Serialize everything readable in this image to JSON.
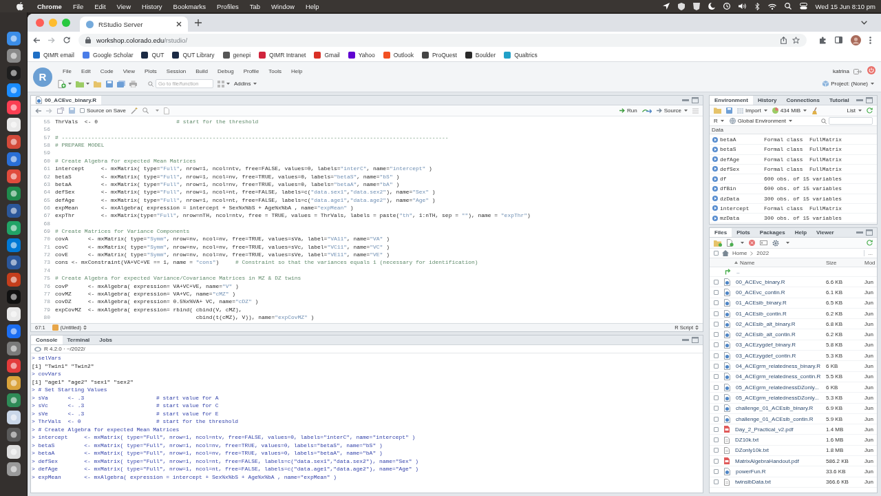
{
  "menubar": {
    "app": "Chrome",
    "items": [
      "File",
      "Edit",
      "View",
      "History",
      "Bookmarks",
      "Profiles",
      "Tab",
      "Window",
      "Help"
    ],
    "clock": "Wed 15 Jun 8:10 pm"
  },
  "browser": {
    "tabs": [
      {
        "title": "RStudio Server",
        "selected": true
      }
    ],
    "url": {
      "host": "workshop.colorado.edu",
      "path": "/rstudio/"
    },
    "bookmarks": [
      {
        "label": "QIMR email",
        "color": "#1f6fc5"
      },
      {
        "label": "Google Scholar",
        "color": "#4a7de8"
      },
      {
        "label": "QUT",
        "color": "#1b2a44"
      },
      {
        "label": "QUT Library",
        "color": "#1b2a44"
      },
      {
        "label": "genepi",
        "color": "#555555"
      },
      {
        "label": "QIMR Intranet",
        "color": "#d0243c"
      },
      {
        "label": "Gmail",
        "color": "#d93025"
      },
      {
        "label": "Yahoo",
        "color": "#5f01d1"
      },
      {
        "label": "Outlook",
        "color": "#f25022"
      },
      {
        "label": "ProQuest",
        "color": "#444444"
      },
      {
        "label": "Boulder",
        "color": "#2a2a2a"
      },
      {
        "label": "Qualtrics",
        "color": "#21a0c8"
      }
    ]
  },
  "rstudio": {
    "logo": "R",
    "menu": [
      "File",
      "Edit",
      "Code",
      "View",
      "Plots",
      "Session",
      "Build",
      "Debug",
      "Profile",
      "Tools",
      "Help"
    ],
    "user": "katrina",
    "goto": {
      "placeholder": "Go to file/function"
    },
    "addins": "Addins",
    "project": "Project: (None)",
    "editor": {
      "tabs": [
        {
          "label": "00_ACEvc_binary.R",
          "selected": true
        }
      ],
      "source_on_save": {
        "label": "Source on Save",
        "checked": false
      },
      "run": "Run",
      "source": "Source",
      "lines": [
        {
          "number": "55",
          "code": "ThrVals  <- 0                        # start for the threshold"
        },
        {
          "number": "56"
        },
        {
          "number": "57",
          "code": "# ----------------------------------------------------------------------------------------------------------------------"
        },
        {
          "number": "58",
          "code": "# PREPARE MODEL"
        },
        {
          "number": "59"
        },
        {
          "number": "60",
          "code": "# Create Algebra for expected Mean Matrices"
        },
        {
          "number": "61",
          "code": "intercept     <- mxMatrix( type=\"Full\", nrow=1, ncol=ntv, free=FALSE, values=0, labels=\"interC\", name=\"intercept\" )"
        },
        {
          "number": "62",
          "code": "betaS         <- mxMatrix( type=\"Full\", nrow=1, ncol=nv, free=TRUE, values=0, labels=\"betaS\", name=\"bS\" )"
        },
        {
          "number": "63",
          "code": "betaA         <- mxMatrix( type=\"Full\", nrow=1, ncol=nv, free=TRUE, values=0, labels=\"betaA\", name=\"bA\" )"
        },
        {
          "number": "64",
          "code": "defSex        <- mxMatrix( type=\"Full\", nrow=1, ncol=nt, free=FALSE, labels=c(\"data.sex1\",\"data.sex2\"), name=\"Sex\" )"
        },
        {
          "number": "65",
          "code": "defAge        <- mxMatrix( type=\"Full\", nrow=1, ncol=nt, free=FALSE, labels=c(\"data.age1\",\"data.age2\"), name=\"Age\" )"
        },
        {
          "number": "66",
          "code": "expMean       <- mxAlgebra( expression = intercept + Sex%x%bS + Age%x%bA , name=\"expMean\" )"
        },
        {
          "number": "67",
          "code": "expThr        <- mxMatrix(type=\"Full\", nrow=nTH, ncol=ntv, free = TRUE, values = ThrVals, labels = paste(\"th\", 1:nTH, sep = \"\"), name = \"expThr\")"
        },
        {
          "number": "68"
        },
        {
          "number": "69",
          "code": "# Create Matrices for Variance Components"
        },
        {
          "number": "70",
          "code": "covA      <- mxMatrix( type=\"Symm\", nrow=nv, ncol=nv, free=TRUE, values=sVa, label=\"VA11\", name=\"VA\" )"
        },
        {
          "number": "71",
          "code": "covC      <- mxMatrix( type=\"Symm\", nrow=nv, ncol=nv, free=TRUE, values=sVc, label=\"VC11\", name=\"VC\" )"
        },
        {
          "number": "72",
          "code": "covE      <- mxMatrix( type=\"Symm\", nrow=nv, ncol=nv, free=TRUE, values=sVe, label=\"VE11\", name=\"VE\" )"
        },
        {
          "number": "73",
          "code": "cons <- mxConstraint(VA+VC+VE == 1, name = \"cons\")     # Constraint so that the variances equals 1 (necessary for identification)"
        },
        {
          "number": "74"
        },
        {
          "number": "75",
          "code": "# Create Algebra for expected Variance/Covariance Matrices in MZ & DZ twins"
        },
        {
          "number": "76",
          "code": "covP      <- mxAlgebra( expression= VA+VC+VE, name=\"V\" )"
        },
        {
          "number": "77",
          "code": "covMZ     <- mxAlgebra( expression= VA+VC, name=\"cMZ\" )"
        },
        {
          "number": "78",
          "code": "covDZ     <- mxAlgebra( expression= 0.5%x%VA+ VC, name=\"cDZ\" )"
        },
        {
          "number": "79",
          "code": "expCovMZ  <- mxAlgebra( expression= rbind( cbind(V, cMZ),"
        },
        {
          "number": "80",
          "code": "                                           cbind(t(cMZ), V)), name=\"expCovMZ\" )"
        }
      ],
      "status": {
        "position": "67:1",
        "scope": "(Untitled)",
        "filetype": "R Script"
      }
    },
    "console": {
      "tabs": [
        {
          "label": "Console",
          "selected": true
        },
        {
          "label": "Terminal",
          "selected": false
        },
        {
          "label": "Jobs",
          "selected": false
        }
      ],
      "header": "R 4.2.0 · ~/2022/",
      "lines": [
        {
          "kind": "input",
          "text": "> selVars"
        },
        {
          "kind": "output",
          "text": "[1] \"Twin1\" \"Twin2\""
        },
        {
          "kind": "input",
          "text": "> covVars"
        },
        {
          "kind": "output",
          "text": "[1] \"age1\" \"age2\" \"sex1\" \"sex2\""
        },
        {
          "kind": "input",
          "text": "> # Set Starting Values"
        },
        {
          "kind": "input",
          "text": "> sVa      <- .3                      # start value for A"
        },
        {
          "kind": "input",
          "text": "> sVc      <- .3                      # start value for C"
        },
        {
          "kind": "input",
          "text": "> sVe      <- .3                      # start value for E"
        },
        {
          "kind": "input",
          "text": "> ThrVals  <- 0                       # start for the threshold"
        },
        {
          "kind": "input",
          "text": "> # Create Algebra for expected Mean Matrices"
        },
        {
          "kind": "input",
          "text": "> intercept     <- mxMatrix( type=\"Full\", nrow=1, ncol=ntv, free=FALSE, values=0, labels=\"interC\", name=\"intercept\" )"
        },
        {
          "kind": "input",
          "text": "> betaS         <- mxMatrix( type=\"Full\", nrow=1, ncol=nv, free=TRUE, values=0, labels=\"betaS\", name=\"bS\" )"
        },
        {
          "kind": "input",
          "text": "> betaA         <- mxMatrix( type=\"Full\", nrow=1, ncol=nv, free=TRUE, values=0, labels=\"betaA\", name=\"bA\" )"
        },
        {
          "kind": "input",
          "text": "> defSex        <- mxMatrix( type=\"Full\", nrow=1, ncol=nt, free=FALSE, labels=c(\"data.sex1\",\"data.sex2\"), name=\"Sex\" )"
        },
        {
          "kind": "input",
          "text": "> defAge        <- mxMatrix( type=\"Full\", nrow=1, ncol=nt, free=FALSE, labels=c(\"data.age1\",\"data.age2\"), name=\"Age\" )"
        },
        {
          "kind": "input",
          "text": "> expMean       <- mxAlgebra( expression = intercept + Sex%x%bS + Age%x%bA , name=\"expMean\" )"
        }
      ]
    },
    "environment": {
      "tabs": [
        {
          "label": "Environment",
          "selected": true
        },
        {
          "label": "History",
          "selected": false
        },
        {
          "label": "Connections",
          "selected": false
        },
        {
          "label": "Tutorial",
          "selected": false
        }
      ],
      "import": "Import",
      "memory": "434 MiB",
      "view": "List",
      "language": "R",
      "scope": "Global Environment",
      "section": "Data",
      "rows": [
        {
          "name": "betaA",
          "value": "Formal class  FullMatrix"
        },
        {
          "name": "betaS",
          "value": "Formal class  FullMatrix"
        },
        {
          "name": "defAge",
          "value": "Formal class  FullMatrix"
        },
        {
          "name": "defSex",
          "value": "Formal class  FullMatrix"
        },
        {
          "name": "df",
          "value": "600 obs. of 15 variables"
        },
        {
          "name": "dfBin",
          "value": "600 obs. of 15 variables"
        },
        {
          "name": "dzData",
          "value": "300 obs. of 15 variables"
        },
        {
          "name": "intercept",
          "value": "Formal class  FullMatrix"
        },
        {
          "name": "mzData",
          "value": "300 obs. of 15 variables"
        }
      ]
    },
    "files": {
      "tabs": [
        {
          "label": "Files",
          "selected": true
        },
        {
          "label": "Plots",
          "selected": false
        },
        {
          "label": "Packages",
          "selected": false
        },
        {
          "label": "Help",
          "selected": false
        },
        {
          "label": "Viewer",
          "selected": false
        }
      ],
      "select_all": false,
      "path": [
        "Home",
        "2022"
      ],
      "more": "...",
      "columns": [
        "Name",
        "Size",
        "Mod"
      ],
      "parent": "..",
      "rows": [
        {
          "kind": "r",
          "name": "00_ACEvc_binary.R",
          "size": "6.6 KB",
          "modified": "Jun",
          "checked": false
        },
        {
          "kind": "r",
          "name": "00_ACEvc_contin.R",
          "size": "6.1 KB",
          "modified": "Jun",
          "checked": false
        },
        {
          "kind": "r",
          "name": "01_ACEsib_binary.R",
          "size": "6.5 KB",
          "modified": "Jun",
          "checked": false
        },
        {
          "kind": "r",
          "name": "01_ACEsib_contin.R",
          "size": "6.2 KB",
          "modified": "Jun",
          "checked": false
        },
        {
          "kind": "r",
          "name": "02_ACEsib_alt_binary.R",
          "size": "6.8 KB",
          "modified": "Jun",
          "checked": false
        },
        {
          "kind": "r",
          "name": "02_ACEsib_alt_contin.R",
          "size": "6.2 KB",
          "modified": "Jun",
          "checked": false
        },
        {
          "kind": "r",
          "name": "03_ACEzygdef_binary.R",
          "size": "5.8 KB",
          "modified": "Jun",
          "checked": false
        },
        {
          "kind": "r",
          "name": "03_ACEzygdef_contin.R",
          "size": "5.3 KB",
          "modified": "Jun",
          "checked": false
        },
        {
          "kind": "r",
          "name": "04_ACEgrm_relatedness_binary.R",
          "size": "6 KB",
          "modified": "Jun",
          "checked": false
        },
        {
          "kind": "r",
          "name": "04_ACEgrm_relatedness_contin.R",
          "size": "5.5 KB",
          "modified": "Jun",
          "checked": false
        },
        {
          "kind": "r",
          "name": "05_ACEgrm_relatednessDZonly...",
          "size": "6 KB",
          "modified": "Jun",
          "checked": false
        },
        {
          "kind": "r",
          "name": "05_ACEgrm_relatednessDZonly...",
          "size": "5.3 KB",
          "modified": "Jun",
          "checked": false
        },
        {
          "kind": "r",
          "name": "challenge_01_ACEsib_binary.R",
          "size": "6.9 KB",
          "modified": "Jun",
          "checked": false
        },
        {
          "kind": "r",
          "name": "challenge_01_ACEsib_contin.R",
          "size": "5.9 KB",
          "modified": "Jun",
          "checked": false
        },
        {
          "kind": "pdf",
          "name": "Day_2_Practical_v2.pdf",
          "size": "1.4 MB",
          "modified": "Jun",
          "checked": false
        },
        {
          "kind": "txt",
          "name": "DZ10k.txt",
          "size": "1.6 MB",
          "modified": "Jun",
          "checked": false
        },
        {
          "kind": "txt",
          "name": "DZonly10k.txt",
          "size": "1.8 MB",
          "modified": "Jun",
          "checked": false
        },
        {
          "kind": "pdf",
          "name": "MatrixAlgebraHandout.pdf",
          "size": "586.2 KB",
          "modified": "Jun",
          "checked": false
        },
        {
          "kind": "r",
          "name": "powerFun.R",
          "size": "33.6 KB",
          "modified": "Jun",
          "checked": false
        },
        {
          "kind": "txt",
          "name": "twinsibData.txt",
          "size": "366.6 KB",
          "modified": "Jun",
          "checked": false
        }
      ]
    }
  }
}
